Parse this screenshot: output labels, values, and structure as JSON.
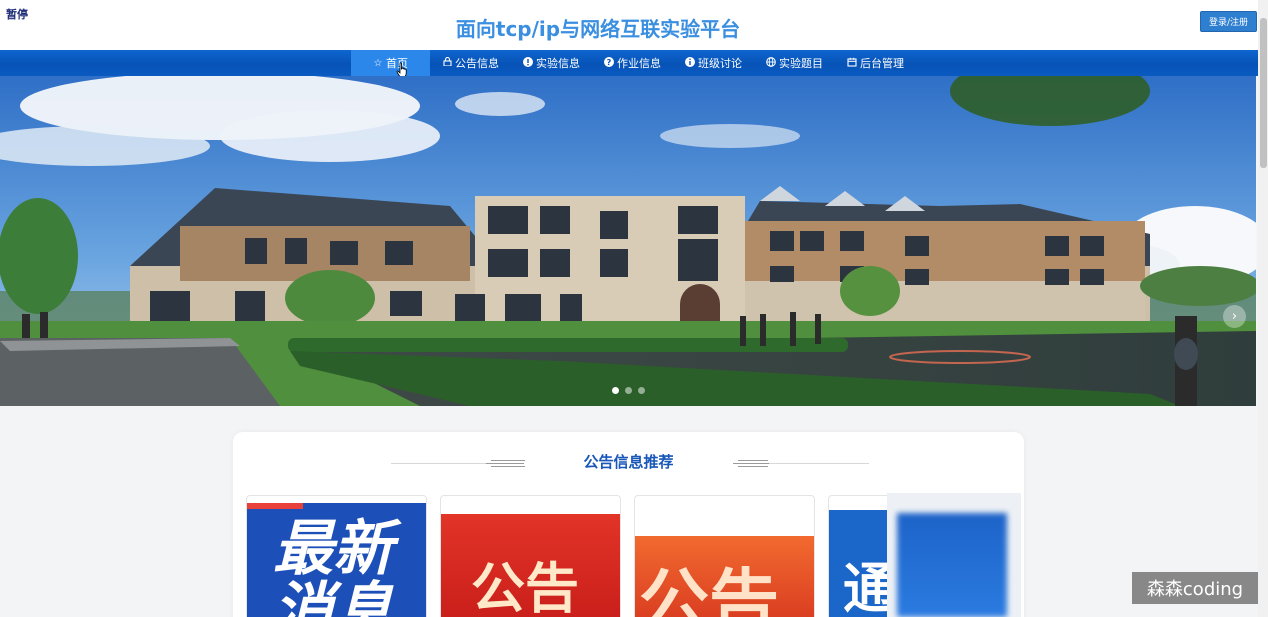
{
  "header": {
    "pause_label": "暂停",
    "title": "面向tcp/ip与网络互联实验平台",
    "login_button": "登录/注册"
  },
  "nav": {
    "items": [
      {
        "icon": "star-icon",
        "label": "首页",
        "active": true
      },
      {
        "icon": "lock-icon",
        "label": "公告信息"
      },
      {
        "icon": "info-icon",
        "label": "实验信息"
      },
      {
        "icon": "question-icon",
        "label": "作业信息"
      },
      {
        "icon": "info-icon",
        "label": "班级讨论"
      },
      {
        "icon": "globe-icon",
        "label": "实验题目"
      },
      {
        "icon": "calendar-icon",
        "label": "后台管理"
      }
    ]
  },
  "banner": {
    "slide_count": 3,
    "active_slide": 1
  },
  "section": {
    "title": "公告信息推荐"
  },
  "cards": [
    {
      "text": "最新消息"
    },
    {
      "text": "公告"
    },
    {
      "text": "公告"
    },
    {
      "text": "通"
    }
  ],
  "watermark": "森森coding",
  "colors": {
    "nav_bg": "#0753b7",
    "nav_active": "#2c87ea",
    "title": "#3b8fe0",
    "section_title": "#1957b8"
  }
}
